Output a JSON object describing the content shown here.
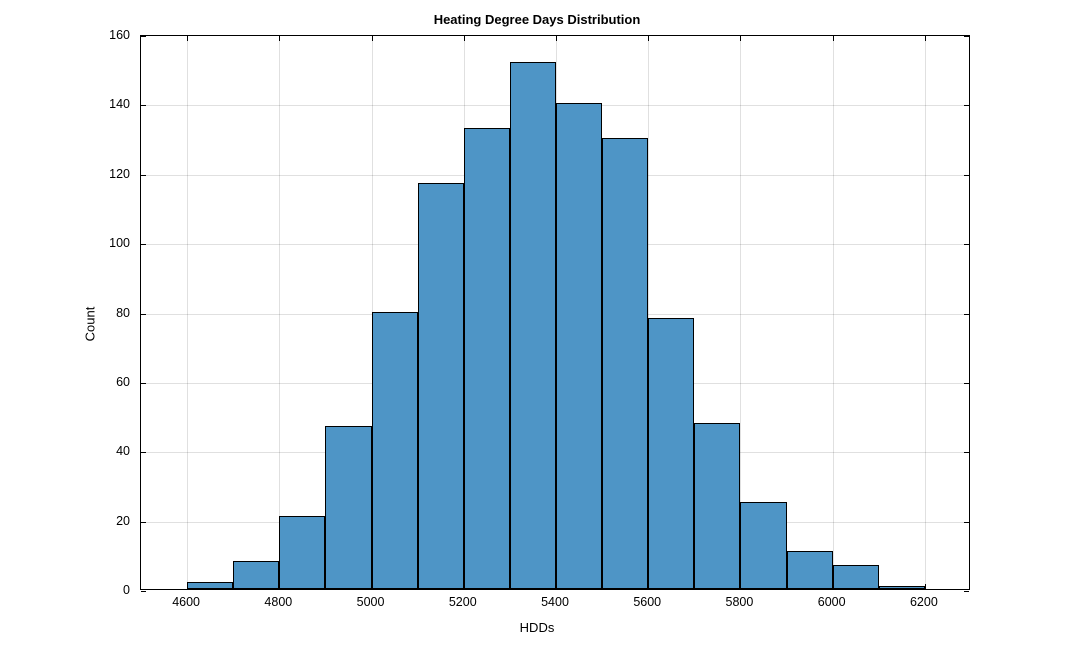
{
  "chart_data": {
    "type": "bar",
    "title": "Heating Degree Days Distribution",
    "xlabel": "HDDs",
    "ylabel": "Count",
    "xlim": [
      4500,
      6300
    ],
    "ylim": [
      0,
      160
    ],
    "xticks": [
      4600,
      4800,
      5000,
      5200,
      5400,
      5600,
      5800,
      6000,
      6200
    ],
    "yticks": [
      0,
      20,
      40,
      60,
      80,
      100,
      120,
      140,
      160
    ],
    "bin_edges": [
      4600,
      4700,
      4800,
      4900,
      5000,
      5100,
      5200,
      5300,
      5400,
      5500,
      5600,
      5700,
      5800,
      5900,
      6000,
      6100,
      6200
    ],
    "values": [
      2,
      8,
      21,
      47,
      80,
      117,
      133,
      152,
      140,
      130,
      78,
      48,
      25,
      11,
      7,
      1
    ]
  }
}
